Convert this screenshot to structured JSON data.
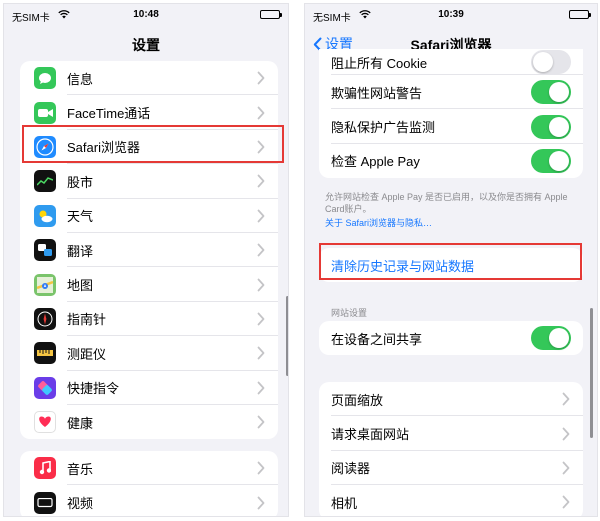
{
  "left": {
    "status": {
      "carrier": "无SIM卡",
      "time": "10:48"
    },
    "nav_title": "设置",
    "group1": [
      {
        "label": "信息",
        "icon": "messages-icon",
        "color": "#34c759"
      },
      {
        "label": "FaceTime通话",
        "icon": "facetime-icon",
        "color": "#34c759"
      },
      {
        "label": "Safari浏览器",
        "icon": "safari-icon",
        "color": "#1f8bff"
      },
      {
        "label": "股市",
        "icon": "stocks-icon",
        "color": "#111111"
      },
      {
        "label": "天气",
        "icon": "weather-icon",
        "color": "#2f9bef"
      },
      {
        "label": "翻译",
        "icon": "translate-icon",
        "color": "#111111"
      },
      {
        "label": "地图",
        "icon": "maps-icon",
        "color": "#7ac46b"
      },
      {
        "label": "指南针",
        "icon": "compass-icon",
        "color": "#111111"
      },
      {
        "label": "测距仪",
        "icon": "measure-icon",
        "color": "#111111"
      },
      {
        "label": "快捷指令",
        "icon": "shortcuts-icon",
        "color": "#6a3de8"
      },
      {
        "label": "健康",
        "icon": "health-icon",
        "color": "#ffffff"
      }
    ],
    "group2": [
      {
        "label": "音乐",
        "icon": "music-icon",
        "color": "#fa2d48"
      },
      {
        "label": "视频",
        "icon": "tv-icon",
        "color": "#111111"
      }
    ]
  },
  "right": {
    "status": {
      "carrier": "无SIM卡",
      "time": "10:39"
    },
    "nav_back": "设置",
    "nav_title": "Safari浏览器",
    "toggles": [
      {
        "label": "阻止所有 Cookie",
        "on": false
      },
      {
        "label": "欺骗性网站警告",
        "on": true
      },
      {
        "label": "隐私保护广告监测",
        "on": true
      },
      {
        "label": "检查 Apple Pay",
        "on": true
      }
    ],
    "footer_text": "允许网站检查 Apple Pay 是否已启用，以及你是否拥有 Apple Card账户。",
    "footer_link": "关于 Safari浏览器与隐私…",
    "clear_history": "清除历史记录与网站数据",
    "section_header": "网站设置",
    "share_toggle": {
      "label": "在设备之间共享",
      "on": true
    },
    "group3": [
      {
        "label": "页面缩放"
      },
      {
        "label": "请求桌面网站"
      },
      {
        "label": "阅读器"
      },
      {
        "label": "相机"
      }
    ]
  },
  "colors": {
    "accent": "#1677ff",
    "toggle_on": "#34c759",
    "highlight": "#e53935"
  }
}
